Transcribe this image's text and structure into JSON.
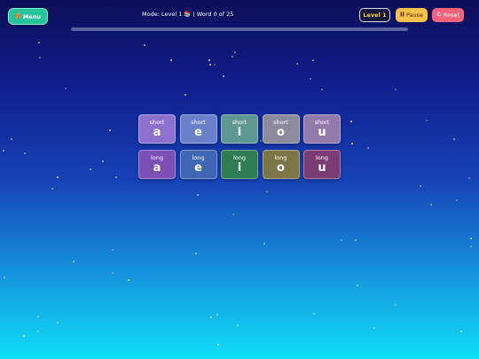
{
  "header": {
    "menu_icon": "home-icon",
    "menu_label": "Menu",
    "status_text": "Mode: Level 1 📚 | Word 0 of 25",
    "progress_fraction": 0,
    "level_label": "Level 1",
    "pause_icon": "pause-icon",
    "pause_label": "Pause",
    "reset_icon": "reset-icon",
    "reset_label": "Reset"
  },
  "tiles": [
    {
      "label": "short",
      "letter": "a",
      "color": "#8e70cf"
    },
    {
      "label": "short",
      "letter": "e",
      "color": "#6b80cb"
    },
    {
      "label": "short",
      "letter": "i",
      "color": "#5f9792"
    },
    {
      "label": "short",
      "letter": "o",
      "color": "#8c8a9c"
    },
    {
      "label": "short",
      "letter": "u",
      "color": "#927aad"
    },
    {
      "label": "long",
      "letter": "a",
      "color": "#7b4fb6"
    },
    {
      "label": "long",
      "letter": "e",
      "color": "#3f65b4"
    },
    {
      "label": "long",
      "letter": "i",
      "color": "#2d7c52"
    },
    {
      "label": "long",
      "letter": "o",
      "color": "#7c7546"
    },
    {
      "label": "long",
      "letter": "u",
      "color": "#7a3c72"
    }
  ],
  "colors": {
    "menu_button": "#28c39b",
    "pause_button": "#fcc14b",
    "reset_button": "#f56178",
    "level_text": "#ffd34d",
    "star": "#f4e27a"
  }
}
